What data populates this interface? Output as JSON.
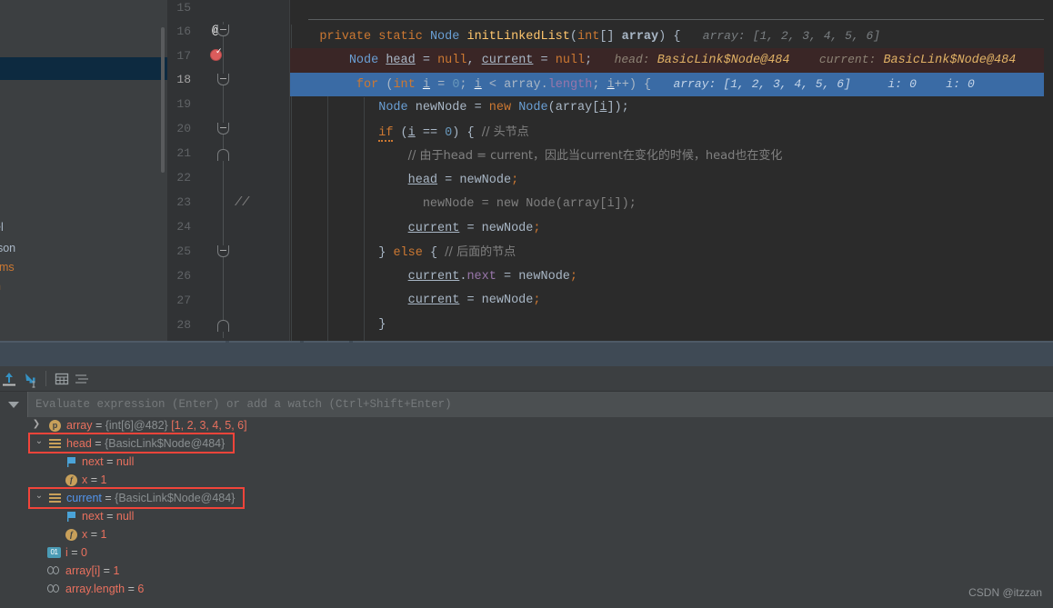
{
  "app": {
    "theme_accent": "#3a6ba5",
    "background": "#3c3f41",
    "editor_background": "#2b2b2b"
  },
  "left_popup": {
    "fragments": [
      "el",
      "rison",
      "ems",
      "h"
    ]
  },
  "editor": {
    "lines": [
      {
        "num": "15",
        "gutter": "",
        "fold": "",
        "text": ""
      },
      {
        "num": "16",
        "gutter": "@",
        "fold": "open",
        "text": "private static Node initLinkedList(int[] array) {",
        "hints": [
          {
            "label": "array:",
            "value": "[1, 2, 3, 4, 5, 6]"
          }
        ]
      },
      {
        "num": "17",
        "gutter": "breakpoint",
        "fold": "",
        "text": "Node head = null, current = null;",
        "hints": [
          {
            "label": "head:",
            "value": "BasicLink$Node@484"
          },
          {
            "label": "current:",
            "value": "BasicLink$Node@484"
          }
        ]
      },
      {
        "num": "18",
        "gutter": "",
        "fold": "open",
        "text": "for (int i = 0; i < array.length; i++) {",
        "hints": [
          {
            "label": "array:",
            "value": "[1, 2, 3, 4, 5, 6]"
          },
          {
            "label": "i:",
            "value": "0"
          },
          {
            "label": "i:",
            "value": "0"
          }
        ]
      },
      {
        "num": "19",
        "gutter": "",
        "fold": "",
        "text": "Node newNode = new Node(array[i]);"
      },
      {
        "num": "20",
        "gutter": "",
        "fold": "open",
        "text": "if (i == 0) { // 头节点"
      },
      {
        "num": "21",
        "gutter": "",
        "fold": "close",
        "text": "// 由于head = current，因此当current在变化的时候，head也在变化"
      },
      {
        "num": "22",
        "gutter": "",
        "fold": "",
        "text": "head = newNode;"
      },
      {
        "num": "23",
        "gutter": "//",
        "fold": "",
        "text": "newNode = new Node(array[i]);"
      },
      {
        "num": "24",
        "gutter": "",
        "fold": "",
        "text": "current = newNode;"
      },
      {
        "num": "25",
        "gutter": "",
        "fold": "open",
        "text": "} else { // 后面的节点"
      },
      {
        "num": "26",
        "gutter": "",
        "fold": "",
        "text": "current.next = newNode;"
      },
      {
        "num": "27",
        "gutter": "",
        "fold": "",
        "text": "current = newNode;"
      },
      {
        "num": "28",
        "gutter": "",
        "fold": "close",
        "text": "}"
      }
    ],
    "tokens": {
      "l16": {
        "kw1": "private",
        "kw2": "static",
        "cls": "Node",
        "meth": "initLinkedList",
        "kw3": "int",
        "brackets": "[]",
        "param": "array"
      },
      "l17": {
        "cls": "Node",
        "v1": "head",
        "kw_null": "null",
        "v2": "current"
      },
      "l18": {
        "kw_for": "for",
        "kw_int": "int",
        "var_i": "i",
        "zero": "0",
        "arr": "array",
        "len": "length"
      },
      "l19": {
        "cls": "Node",
        "var": "newNode",
        "kw_new": "new",
        "ctor": "Node",
        "arr": "array",
        "idx": "i"
      },
      "l20": {
        "kw_if": "if",
        "var_i": "i",
        "zero": "0",
        "comment": "// 头节点"
      },
      "l21": {
        "comment": "// 由于head = current，因此当current在变化的时候，head也在变化"
      },
      "l22": {
        "v": "head",
        "nn": "newNode"
      },
      "l23": {
        "nn1": "newNode",
        "kw_new": "new",
        "ctor": "Node",
        "arr": "array",
        "idx": "i"
      },
      "l24": {
        "v": "current",
        "nn": "newNode"
      },
      "l25": {
        "kw_else": "else",
        "comment": "// 后面的节点"
      },
      "l26": {
        "v": "current",
        "fld": "next",
        "nn": "newNode"
      },
      "l27": {
        "v": "current",
        "nn": "newNode"
      },
      "l28": {
        "brace": "}"
      }
    }
  },
  "debugger": {
    "toolbar": {
      "icons": [
        {
          "name": "step-out-icon",
          "title": "Step Out"
        },
        {
          "name": "drop-frame-icon",
          "title": "Run to Cursor"
        },
        {
          "name": "table-view-icon",
          "title": "View as Table"
        },
        {
          "name": "group-by-type-icon",
          "title": "Group by Type"
        }
      ]
    },
    "evaluate": {
      "placeholder": "Evaluate expression (Enter) or add a watch (Ctrl+Shift+Enter)",
      "value": "",
      "dropdown_icon": "chevron-down-icon"
    },
    "variables": [
      {
        "indent": 0,
        "arrow": "collapsed",
        "icon": "param",
        "icon_glyph": "p",
        "name": "array",
        "eq": " = ",
        "type": "{int[6]@482}",
        "value": " [1, 2, 3, 4, 5, 6]",
        "highlight": false
      },
      {
        "indent": 0,
        "arrow": "expanded",
        "icon": "object",
        "icon_glyph": "",
        "name": "head",
        "eq": " = ",
        "type": "{BasicLink$Node@484}",
        "value": "",
        "highlight": true
      },
      {
        "indent": 1,
        "arrow": "none",
        "icon": "flag",
        "icon_glyph": "",
        "name": "next",
        "eq": " = ",
        "type": "",
        "value": "null",
        "highlight": false
      },
      {
        "indent": 1,
        "arrow": "none",
        "icon": "field",
        "icon_glyph": "f",
        "name": "x",
        "eq": " = ",
        "type": "",
        "value": "1",
        "highlight": false
      },
      {
        "indent": 0,
        "arrow": "expanded",
        "icon": "object",
        "icon_glyph": "",
        "name": "current",
        "eq": " = ",
        "type": "{BasicLink$Node@484}",
        "value": "",
        "highlight": true,
        "name_color": "blue"
      },
      {
        "indent": 1,
        "arrow": "none",
        "icon": "flag",
        "icon_glyph": "",
        "name": "next",
        "eq": " = ",
        "type": "",
        "value": "null",
        "highlight": false
      },
      {
        "indent": 1,
        "arrow": "none",
        "icon": "field",
        "icon_glyph": "f",
        "name": "x",
        "eq": " = ",
        "type": "",
        "value": "1",
        "highlight": false
      },
      {
        "indent": 0,
        "arrow": "none",
        "icon": "primitive",
        "icon_glyph": "01",
        "name": "i",
        "eq": " = ",
        "type": "",
        "value": "0",
        "highlight": false
      },
      {
        "indent": 0,
        "arrow": "none",
        "icon": "watch",
        "icon_glyph": "",
        "name": "array[i]",
        "eq": " = ",
        "type": "",
        "value": "1",
        "highlight": false
      },
      {
        "indent": 0,
        "arrow": "none",
        "icon": "watch",
        "icon_glyph": "",
        "name": "array.length",
        "eq": " = ",
        "type": "",
        "value": "6",
        "highlight": false
      }
    ],
    "annotation_color": "#f2443a"
  },
  "watermark": "CSDN @itzzan"
}
